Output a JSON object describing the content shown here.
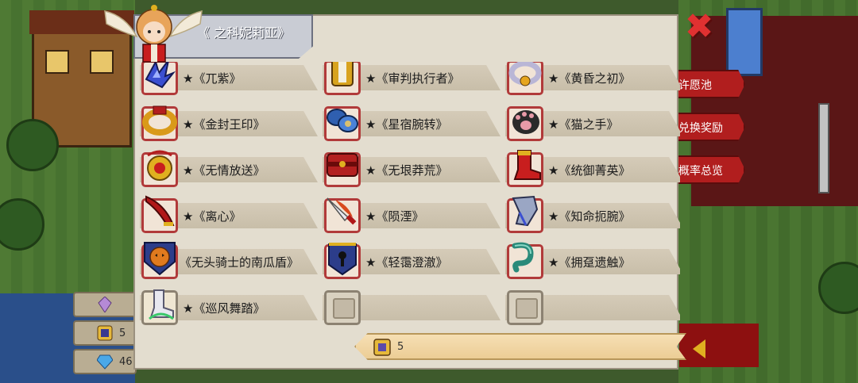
{
  "title": "《 之科妮莉亚》",
  "side_menu": [
    "许愿池",
    "兑换奖励",
    "概率总览"
  ],
  "left_currency": [
    {
      "value": "",
      "icon": "crystal-icon"
    },
    {
      "value": "5",
      "icon": "ticket-icon"
    },
    {
      "value": "46",
      "icon": "diamond-icon"
    }
  ],
  "items": [
    {
      "name": "★《兀紫》",
      "icon": "blue-claw-icon",
      "color": "#3b4fd1"
    },
    {
      "name": "★《审判执行者》",
      "icon": "gold-gauntlet-icon",
      "color": "#d8a31e"
    },
    {
      "name": "★《黄昏之初》",
      "icon": "silver-ring-icon",
      "color": "#b9b6d6"
    },
    {
      "name": "★《金封王印》",
      "icon": "gold-ring-icon",
      "color": "#d99a1a"
    },
    {
      "name": "★《星宿腕转》",
      "icon": "blue-bracer-icon",
      "color": "#2f5fb0"
    },
    {
      "name": "★《猫之手》",
      "icon": "cat-paw-icon",
      "color": "#2a2a2a"
    },
    {
      "name": "★《无情放送》",
      "icon": "gold-amulet-icon",
      "color": "#e0b020"
    },
    {
      "name": "★《无垠莽荒》",
      "icon": "red-chest-icon",
      "color": "#b32020"
    },
    {
      "name": "★《统御菁英》",
      "icon": "red-boot-icon",
      "color": "#c81e1e"
    },
    {
      "name": "★《离心》",
      "icon": "red-blade-icon",
      "color": "#b01818"
    },
    {
      "name": "★《陨湮》",
      "icon": "flame-sword-icon",
      "color": "#d84a1e"
    },
    {
      "name": "★《知命扼腕》",
      "icon": "silver-gauntlet-icon",
      "color": "#9aa6c4"
    },
    {
      "name": "《无头骑士的南瓜盾》",
      "icon": "pumpkin-shield-icon",
      "color": "#e07a1e"
    },
    {
      "name": "★《轻霭澄澈》",
      "icon": "keyhole-shield-icon",
      "color": "#2c3d8a"
    },
    {
      "name": "★《拥趸遗触》",
      "icon": "tentacle-icon",
      "color": "#2a8a7a"
    },
    {
      "name": "★《巡风舞踏》",
      "icon": "white-boot-icon",
      "color": "#e8e8f0"
    },
    {
      "name": "",
      "icon": "empty-slot-icon",
      "color": ""
    },
    {
      "name": "",
      "icon": "empty-slot-icon",
      "color": ""
    }
  ],
  "counter": {
    "value": "5",
    "icon": "ticket-icon"
  },
  "close_icon": "close-icon"
}
